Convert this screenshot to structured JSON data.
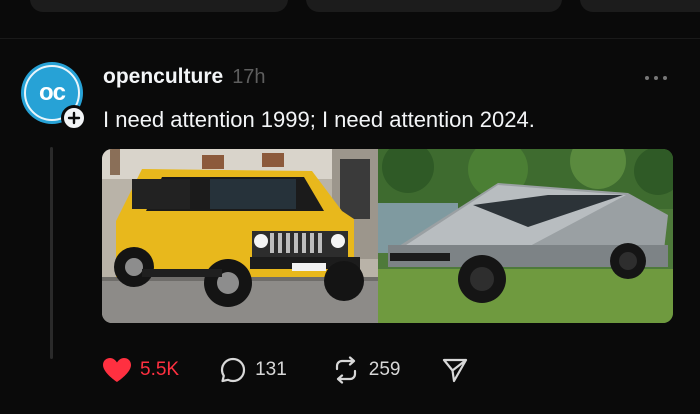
{
  "post": {
    "username": "openculture",
    "time": "17h",
    "avatar_text": "oc",
    "caption": "I need attention 1999; I need attention 2024.",
    "media": {
      "left_image": "yellow Hummer H2 SUV",
      "right_image": "silver Tesla Cybertruck"
    },
    "actions": {
      "likes": "5.5K",
      "replies": "131",
      "reposts": "259"
    }
  },
  "colors": {
    "background": "#0a0a0a",
    "like_active": "#ff3040",
    "avatar": "#27a2d6",
    "muted_text": "#5e5e5e"
  },
  "icons": [
    "plus-icon",
    "more-icon",
    "heart-icon",
    "reply-icon",
    "repost-icon",
    "share-icon"
  ]
}
